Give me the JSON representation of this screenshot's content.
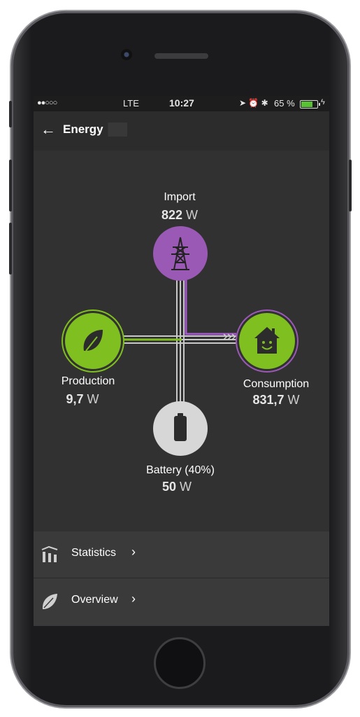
{
  "status": {
    "signal_dots": "●●○○○",
    "network": "LTE",
    "time": "10:27",
    "battery_pct": "65 %"
  },
  "header": {
    "title": "Energy",
    "back_icon": "arrow-left-icon"
  },
  "flow": {
    "import": {
      "label": "Import",
      "value_num": "822",
      "unit": "W",
      "icon": "power-tower-icon"
    },
    "production": {
      "label": "Production",
      "value_num": "9,7",
      "unit": "W",
      "icon": "leaf-icon"
    },
    "consumption": {
      "label": "Consumption",
      "value_num": "831,7",
      "unit": "W",
      "icon": "house-icon"
    },
    "battery": {
      "label": "Battery (40%)",
      "value_num": "50",
      "unit": "W",
      "icon": "battery-icon"
    }
  },
  "menu": [
    {
      "label": "Statistics",
      "icon": "statistics-icon"
    },
    {
      "label": "Overview",
      "icon": "leaf-icon"
    }
  ],
  "colors": {
    "purple": "#9b59b6",
    "green": "#7fbf1f",
    "gray": "#c8c8c8",
    "bg": "#313131"
  }
}
